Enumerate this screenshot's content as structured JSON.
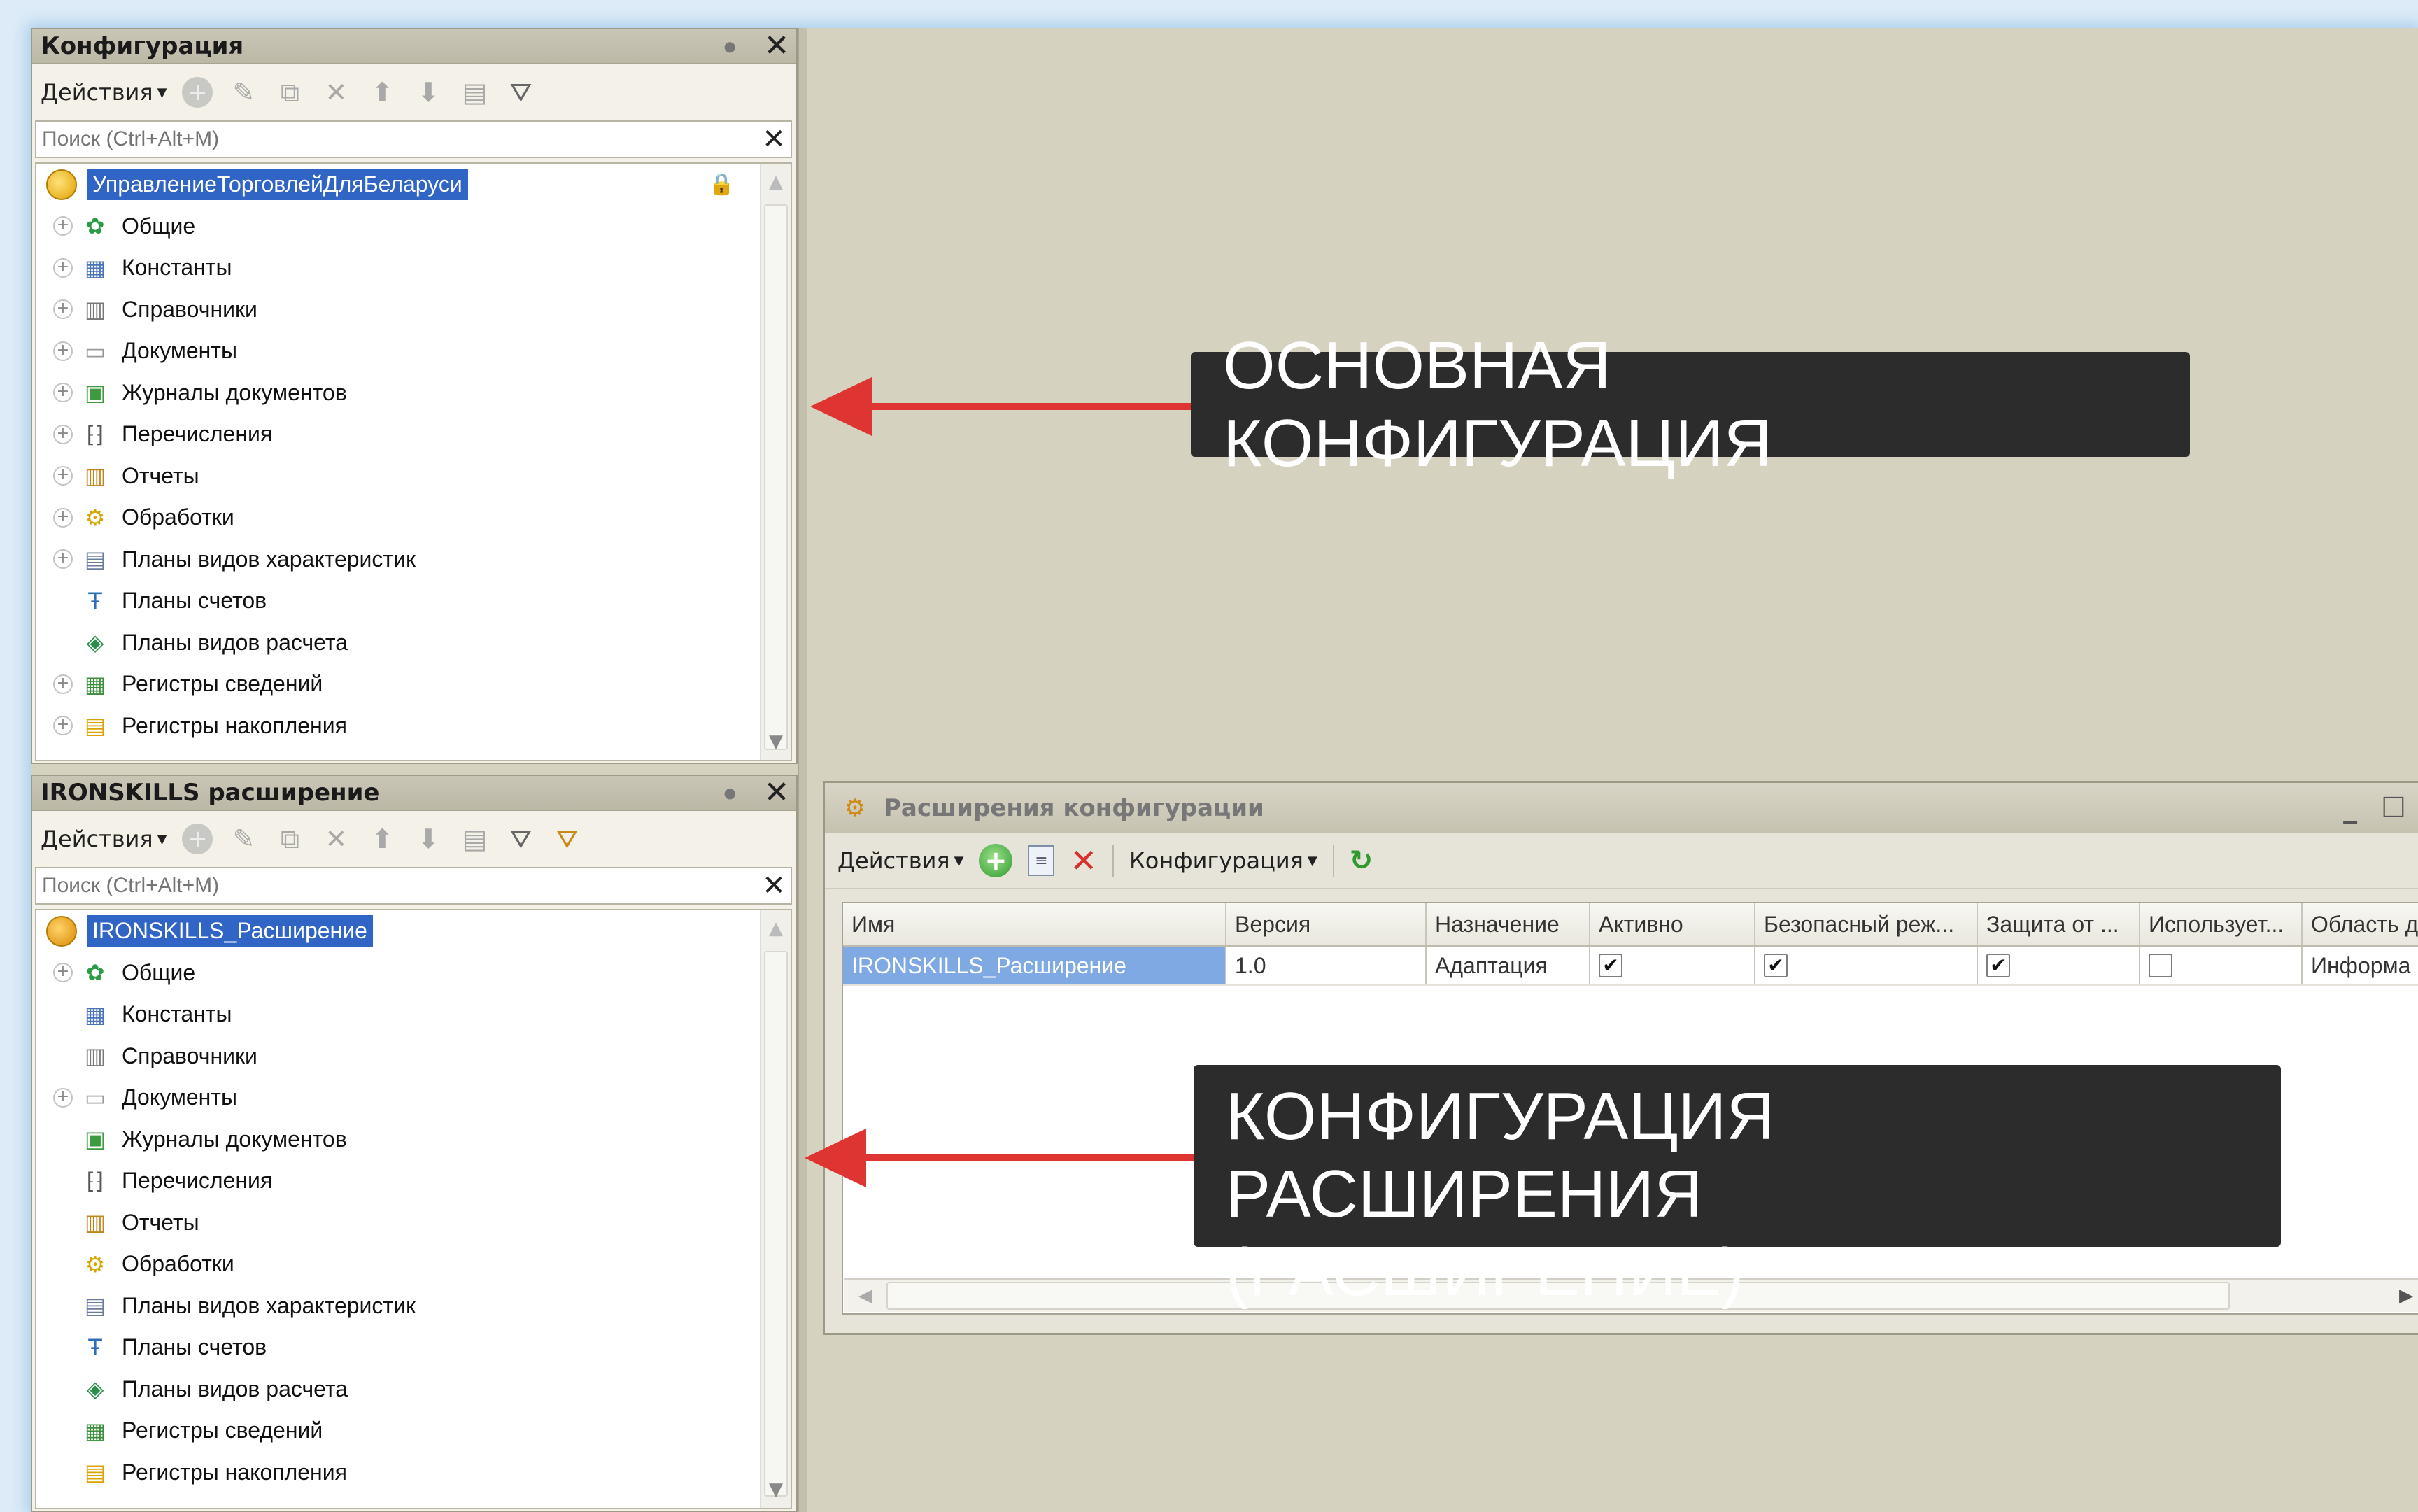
{
  "main_panel": {
    "title": "Конфигурация",
    "actions_label": "Действия",
    "search_placeholder": "Поиск (Ctrl+Alt+M)",
    "root_label": "УправлениеТорговлейДляБеларуси",
    "items": [
      {
        "label": "Общие",
        "icon": "common-icon",
        "expandable": true
      },
      {
        "label": "Константы",
        "icon": "constants-icon",
        "expandable": true
      },
      {
        "label": "Справочники",
        "icon": "catalogs-icon",
        "expandable": true
      },
      {
        "label": "Документы",
        "icon": "documents-icon",
        "expandable": true
      },
      {
        "label": "Журналы документов",
        "icon": "journals-icon",
        "expandable": true
      },
      {
        "label": "Перечисления",
        "icon": "enums-icon",
        "expandable": true
      },
      {
        "label": "Отчеты",
        "icon": "reports-icon",
        "expandable": true
      },
      {
        "label": "Обработки",
        "icon": "processing-icon",
        "expandable": true
      },
      {
        "label": "Планы видов характеристик",
        "icon": "chart-types-icon",
        "expandable": true
      },
      {
        "label": "Планы счетов",
        "icon": "accounts-icon",
        "expandable": false
      },
      {
        "label": "Планы видов расчета",
        "icon": "calc-types-icon",
        "expandable": false
      },
      {
        "label": "Регистры сведений",
        "icon": "info-registers-icon",
        "expandable": true
      },
      {
        "label": "Регистры накопления",
        "icon": "accum-registers-icon",
        "expandable": true
      }
    ]
  },
  "ext_panel": {
    "title": "IRONSKILLS расширение",
    "actions_label": "Действия",
    "search_placeholder": "Поиск (Ctrl+Alt+M)",
    "root_label": "IRONSKILLS_Расширение",
    "items": [
      {
        "label": "Общие",
        "icon": "common-icon",
        "expandable": true
      },
      {
        "label": "Константы",
        "icon": "constants-icon",
        "expandable": false
      },
      {
        "label": "Справочники",
        "icon": "catalogs-icon",
        "expandable": false
      },
      {
        "label": "Документы",
        "icon": "documents-icon",
        "expandable": true
      },
      {
        "label": "Журналы документов",
        "icon": "journals-icon",
        "expandable": false
      },
      {
        "label": "Перечисления",
        "icon": "enums-icon",
        "expandable": false
      },
      {
        "label": "Отчеты",
        "icon": "reports-icon",
        "expandable": false
      },
      {
        "label": "Обработки",
        "icon": "processing-icon",
        "expandable": false
      },
      {
        "label": "Планы видов характеристик",
        "icon": "chart-types-icon",
        "expandable": false
      },
      {
        "label": "Планы счетов",
        "icon": "accounts-icon",
        "expandable": false
      },
      {
        "label": "Планы видов расчета",
        "icon": "calc-types-icon",
        "expandable": false
      },
      {
        "label": "Регистры сведений",
        "icon": "info-registers-icon",
        "expandable": false
      },
      {
        "label": "Регистры накопления",
        "icon": "accum-registers-icon",
        "expandable": false
      }
    ]
  },
  "extensions_window": {
    "title": "Расширения конфигурации",
    "toolbar": {
      "actions_label": "Действия",
      "configuration_label": "Конфигурация"
    },
    "columns": [
      "Имя",
      "Версия",
      "Назначение",
      "Активно",
      "Безопасный реж...",
      "Защита от ...",
      "Использует...",
      "Область д"
    ],
    "rows": [
      {
        "name": "IRONSKILLS_Расширение",
        "version": "1.0",
        "purpose": "Адаптация",
        "active": true,
        "safe_mode": true,
        "protection": true,
        "uses": false,
        "scope": "Информа"
      }
    ]
  },
  "annotations": {
    "main_label": "ОСНОВНАЯ КОНФИГУРАЦИЯ",
    "ext_label": "КОНФИГУРАЦИЯ РАСШИРЕНИЯ\n(РАСШИРЕНИЕ)"
  },
  "colors": {
    "arrow": "#de3432",
    "callout_bg": "#2c2c2c",
    "selection": "#3165c5",
    "desktop_bg": "#d6d2c0"
  }
}
